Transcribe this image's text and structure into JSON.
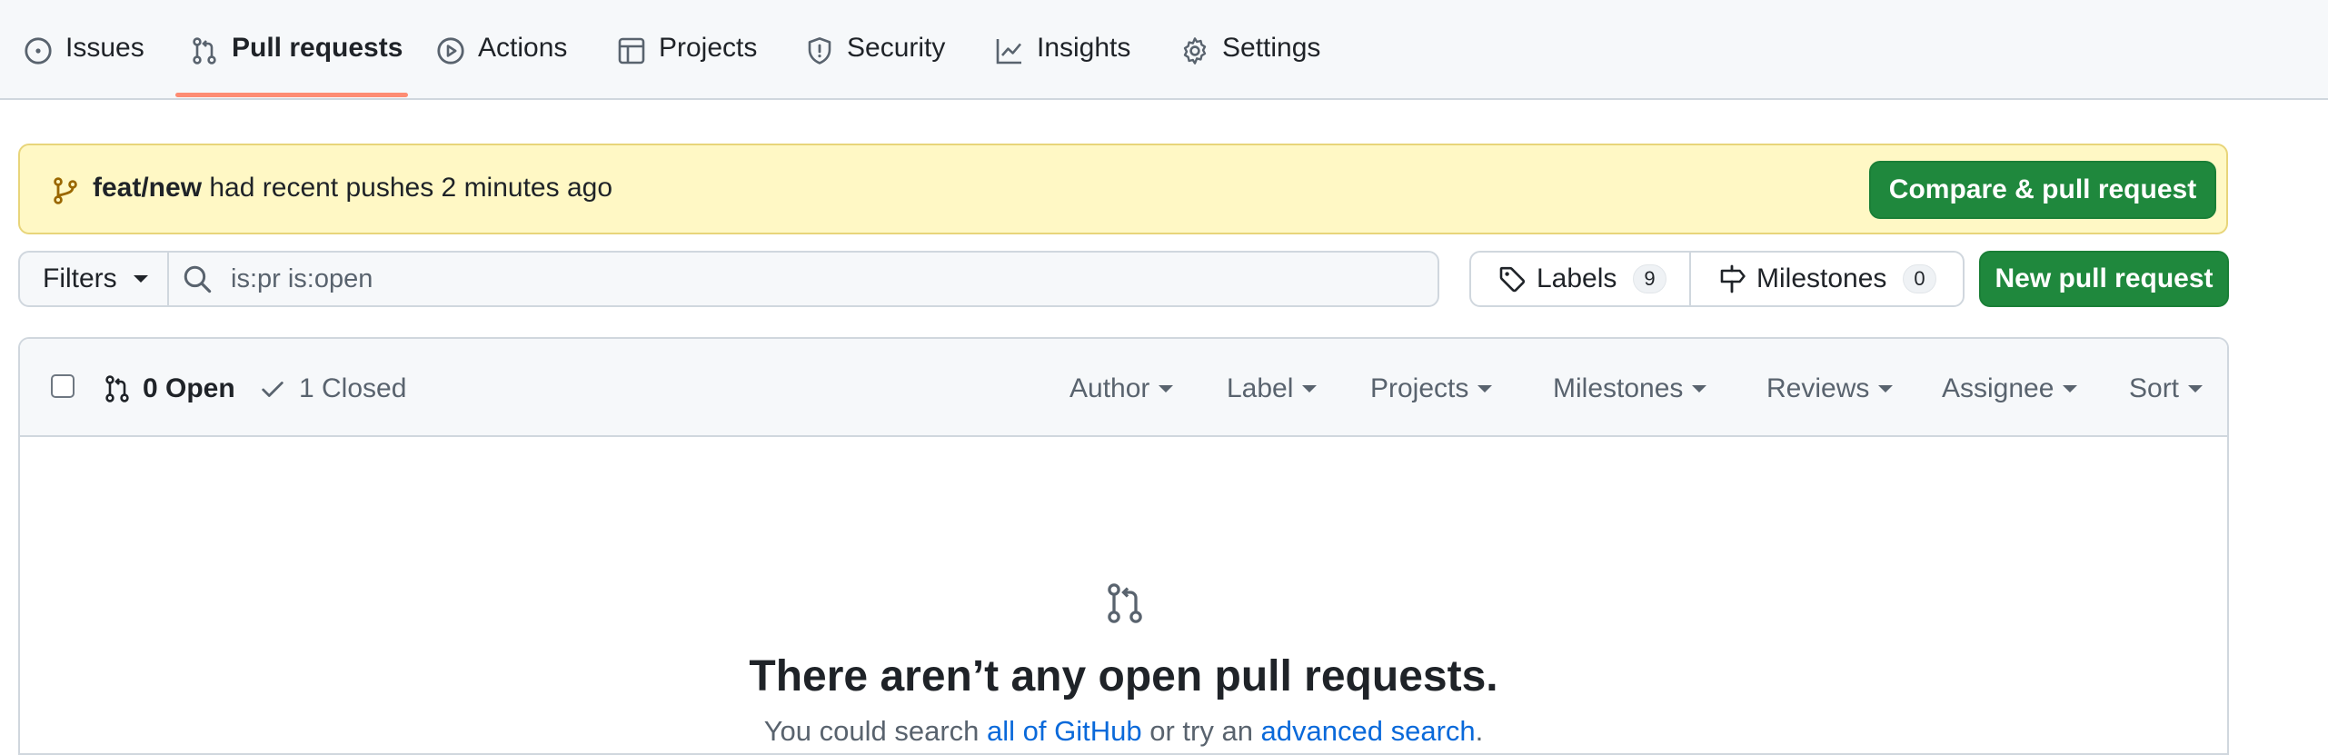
{
  "nav": {
    "tabs": [
      {
        "label": "Issues",
        "icon": "issue-opened-icon"
      },
      {
        "label": "Pull requests",
        "icon": "git-pull-request-icon",
        "selected": true
      },
      {
        "label": "Actions",
        "icon": "play-icon"
      },
      {
        "label": "Projects",
        "icon": "table-icon"
      },
      {
        "label": "Security",
        "icon": "shield-icon"
      },
      {
        "label": "Insights",
        "icon": "graph-icon"
      },
      {
        "label": "Settings",
        "icon": "gear-icon"
      }
    ],
    "selected_underline_color": "#fd8c73"
  },
  "banner": {
    "branch": "feat/new",
    "message": "had recent pushes 2 minutes ago",
    "compare_button": "Compare & pull request"
  },
  "toolbar": {
    "filters_label": "Filters",
    "search_value": "is:pr is:open",
    "labels_label": "Labels",
    "labels_count": "9",
    "milestones_label": "Milestones",
    "milestones_count": "0",
    "new_pr_label": "New pull request"
  },
  "list": {
    "open_label": "0 Open",
    "closed_label": "1 Closed",
    "filters": [
      "Author",
      "Label",
      "Projects",
      "Milestones",
      "Reviews",
      "Assignee",
      "Sort"
    ]
  },
  "empty_state": {
    "title": "There aren’t any open pull requests.",
    "sub_prefix": "You could search ",
    "sub_link1": "all of GitHub",
    "sub_middle": " or try an ",
    "sub_link2": "advanced search",
    "sub_suffix": "."
  },
  "colors": {
    "primary_button": "#1f883d",
    "banner_bg": "#fff8c5",
    "link": "#0969da"
  }
}
